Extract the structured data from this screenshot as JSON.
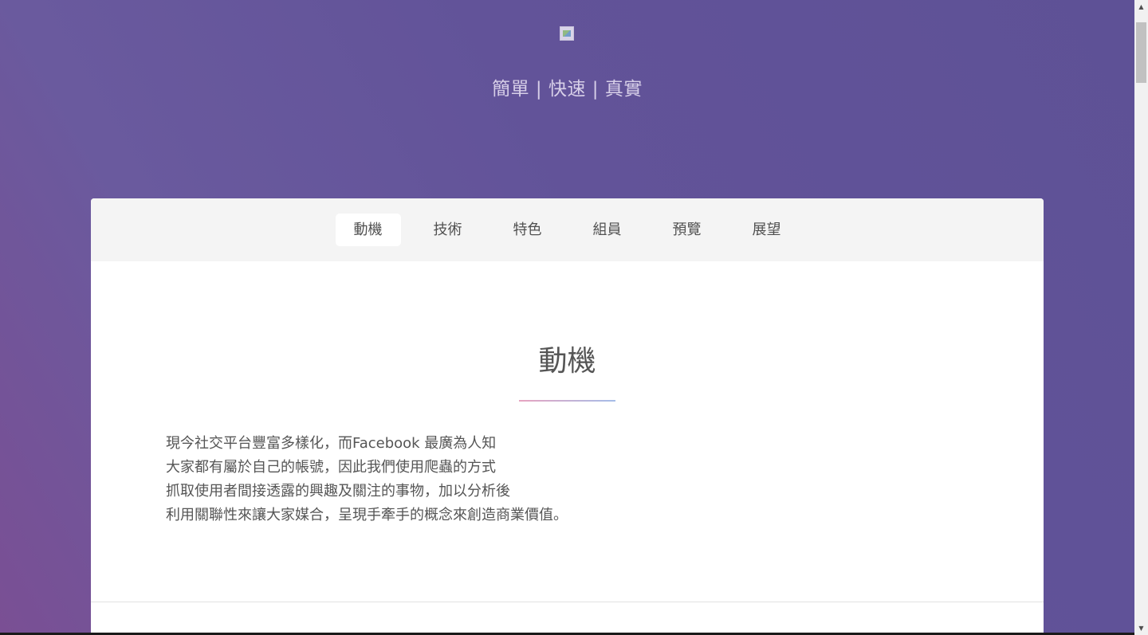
{
  "header": {
    "logo_icon": "broken-image-icon",
    "tagline": "簡單 | 快速 | 真實"
  },
  "tabs": [
    {
      "label": "動機",
      "active": true
    },
    {
      "label": "技術",
      "active": false
    },
    {
      "label": "特色",
      "active": false
    },
    {
      "label": "組員",
      "active": false
    },
    {
      "label": "預覽",
      "active": false
    },
    {
      "label": "展望",
      "active": false
    }
  ],
  "section": {
    "title": "動機",
    "paragraph_lines": [
      "現今社交平台豐富多樣化，而Facebook 最廣為人知",
      "大家都有屬於自己的帳號，因此我們使用爬蟲的方式",
      "抓取使用者間接透露的興趣及關注的事物，加以分析後",
      "利用關聯性來讓大家媒合，呈現手牽手的概念來創造商業價值。"
    ]
  },
  "colors": {
    "background_purple": "#625399",
    "card_bg": "#ffffff",
    "tabbar_bg": "#f4f4f4",
    "underline_pink": "#e7a4c0",
    "underline_blue": "#a5bde8"
  },
  "scrollbar": {
    "up_icon": "arrow-up-icon",
    "down_icon": "arrow-down-icon"
  }
}
